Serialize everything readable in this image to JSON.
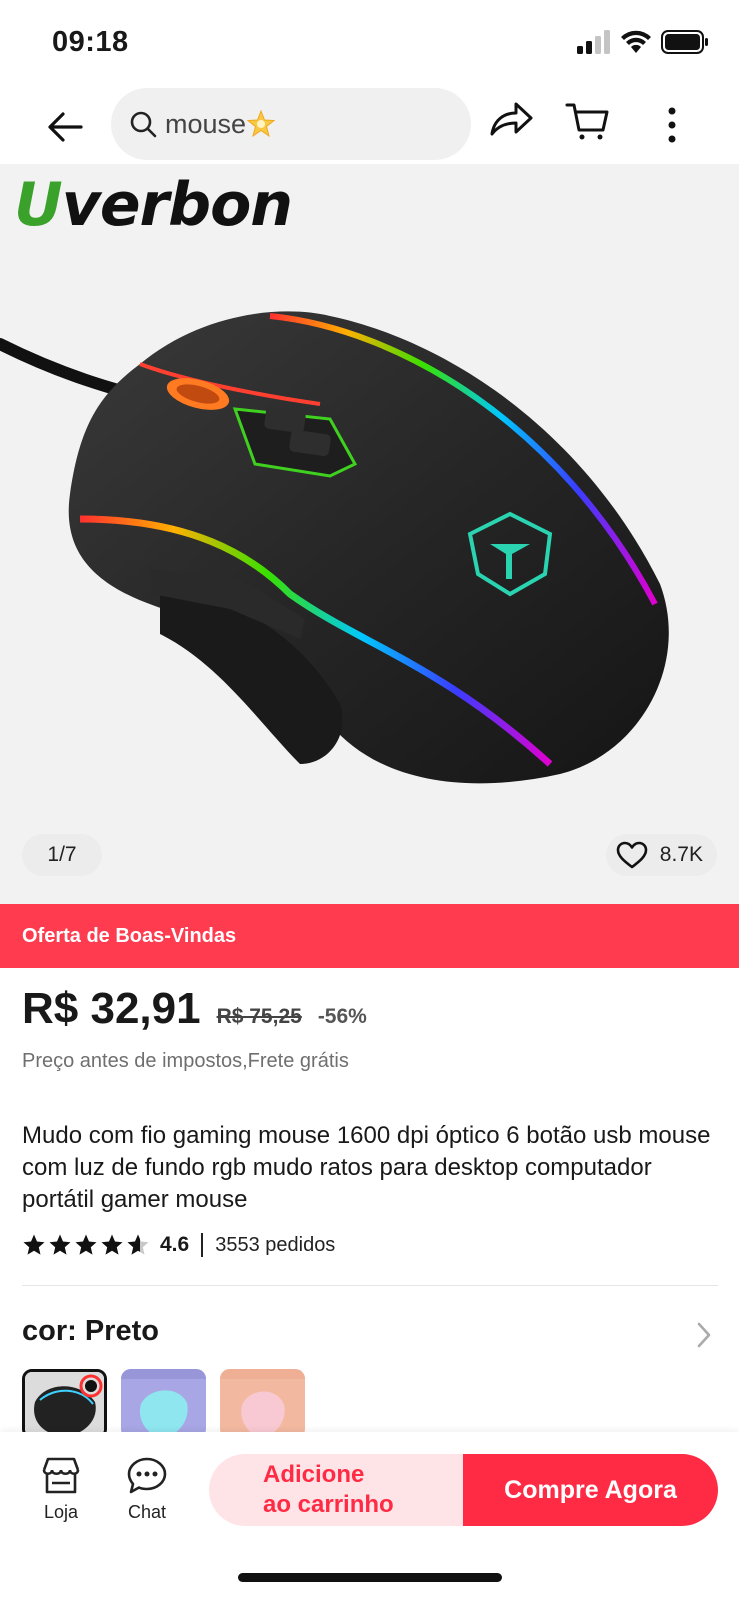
{
  "status_bar": {
    "time": "09:18"
  },
  "search": {
    "query": "mouse"
  },
  "brand": {
    "first_letter": "U",
    "rest": "verbon"
  },
  "gallery": {
    "counter": "1/7",
    "likes": "8.7K"
  },
  "banner": {
    "text": "Oferta de Boas-Vindas"
  },
  "price": {
    "current": "R$ 32,91",
    "original": "R$ 75,25",
    "discount": "-56%",
    "note": "Preço antes de impostos,Frete grátis"
  },
  "product": {
    "title": "Mudo com fio gaming mouse 1600 dpi óptico 6 botão usb mouse com luz de fundo rgb mudo ratos para desktop computador portátil gamer mouse",
    "rating": "4.6",
    "rating_stars": 4.6,
    "orders": "3553 pedidos"
  },
  "variant": {
    "label": "cor: Preto"
  },
  "bottom_bar": {
    "store_label": "Loja",
    "chat_label": "Chat",
    "add_to_cart_line1": "Adicione",
    "add_to_cart_line2": "ao carrinho",
    "buy_now": "Compre Agora"
  },
  "colors": {
    "accent": "#ff2b45",
    "banner": "#ff3b4f",
    "cart_bg": "#ffe4e7"
  }
}
